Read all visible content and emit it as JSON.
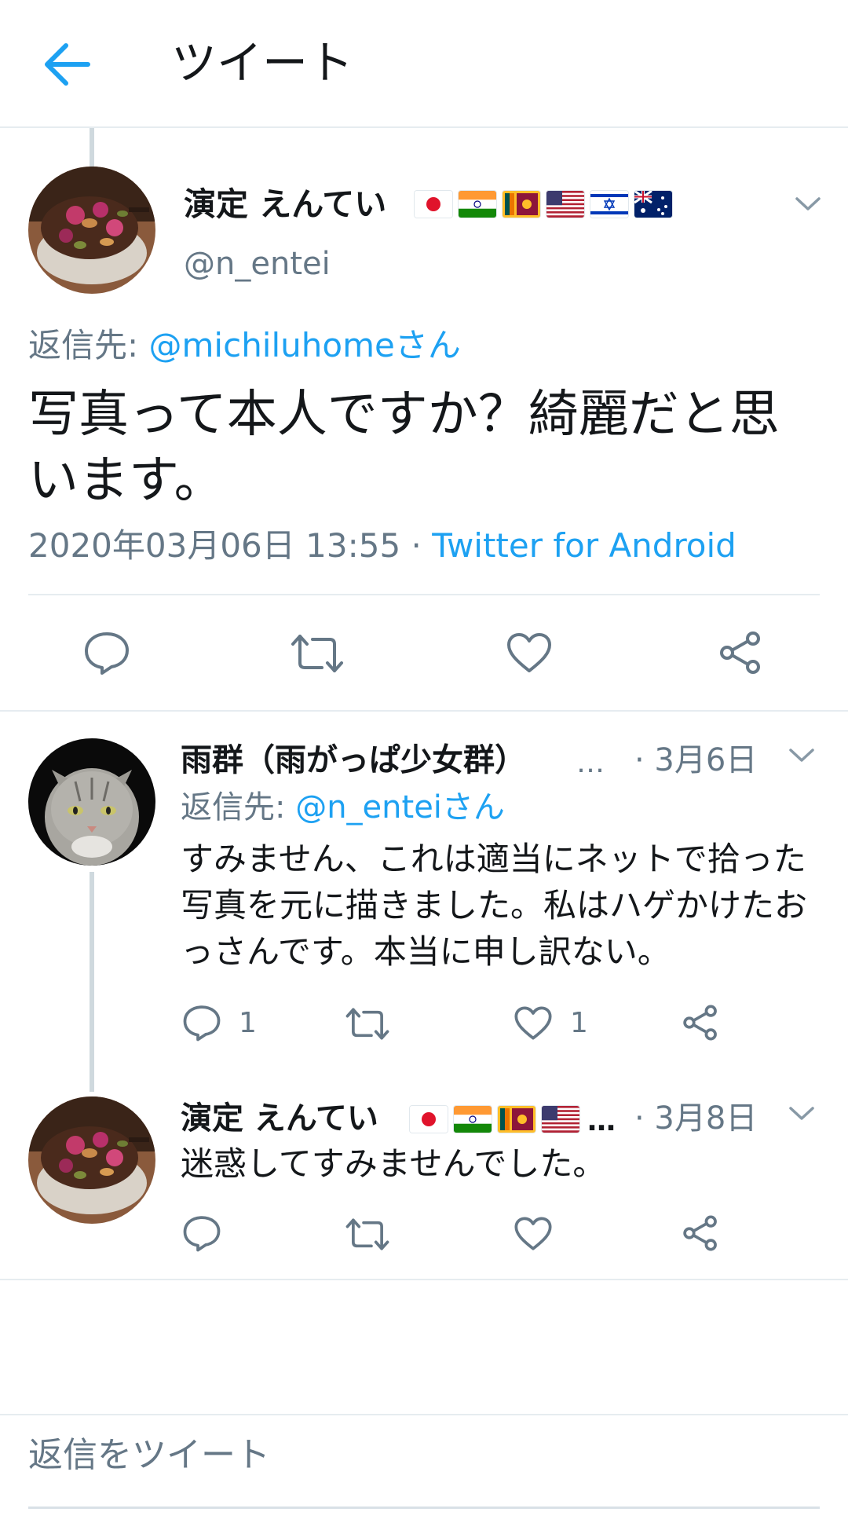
{
  "header": {
    "title": "ツイート",
    "back_icon": "back-arrow-icon"
  },
  "colors": {
    "accent": "#1da1f2",
    "secondary_text": "#657786",
    "divider": "#e6ecf0"
  },
  "main_tweet": {
    "display_name": "演定 えんてい",
    "flags": [
      "jp-flag-icon",
      "in-flag-icon",
      "lk-flag-icon",
      "us-flag-icon",
      "il-flag-icon",
      "au-flag-icon"
    ],
    "handle": "@n_entei",
    "reply_prefix": "返信先: ",
    "reply_to": "@michiluhomeさん",
    "text": "写真って本人ですか？綺麗だと思います。",
    "timestamp": "2020年03月06日 13:55",
    "separator": " · ",
    "source": "Twitter for Android",
    "actions": [
      "reply-icon",
      "retweet-icon",
      "like-icon",
      "share-icon"
    ]
  },
  "replies": [
    {
      "display_name": "雨群（雨がっぱ少女群）",
      "ellipsis": "…",
      "date": "· 3月6日",
      "reply_prefix": "返信先: ",
      "reply_to": "@n_enteiさん",
      "text": "すみません、これは適当にネットで拾った写真を元に描きました。私はハゲかけたおっさんです。本当に申し訳ない。",
      "reply_count": "1",
      "like_count": "1"
    },
    {
      "display_name": "演定 えんてい",
      "flags": [
        "jp-flag-icon",
        "in-flag-icon",
        "lk-flag-icon",
        "us-flag-icon"
      ],
      "ellipsis": "…",
      "date": "· 3月8日",
      "text": "迷惑してすみませんでした。",
      "reply_count": "",
      "like_count": ""
    }
  ],
  "composer": {
    "placeholder": "返信をツイート"
  }
}
